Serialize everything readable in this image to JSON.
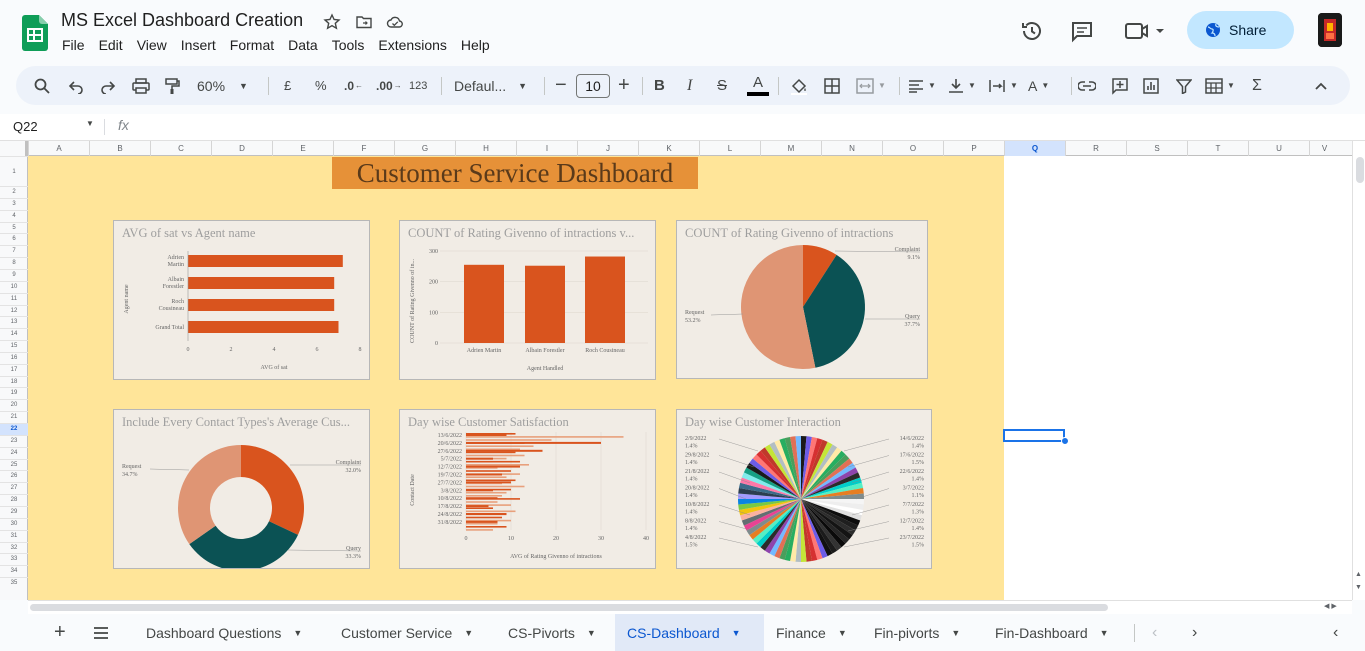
{
  "document": {
    "title": "MS Excel Dashboard Creation"
  },
  "menu": [
    "File",
    "Edit",
    "View",
    "Insert",
    "Format",
    "Data",
    "Tools",
    "Extensions",
    "Help"
  ],
  "header": {
    "share_label": "Share"
  },
  "toolbar": {
    "zoom": "60%",
    "currency": "£",
    "percent": "%",
    "dec_less": ".0",
    "dec_more": ".00",
    "number_format": "123",
    "font_name": "Defaul...",
    "font_size": "10"
  },
  "formula_bar": {
    "cell_ref": "Q22",
    "fx": "fx",
    "content": ""
  },
  "columns": [
    "A",
    "B",
    "C",
    "D",
    "E",
    "F",
    "G",
    "H",
    "I",
    "J",
    "K",
    "L",
    "M",
    "N",
    "O",
    "P",
    "Q",
    "R",
    "S",
    "T",
    "U",
    "V"
  ],
  "rows": [
    "1",
    "2",
    "3",
    "4",
    "5",
    "6",
    "7",
    "8",
    "9",
    "10",
    "11",
    "12",
    "13",
    "14",
    "15",
    "16",
    "17",
    "18",
    "19",
    "20",
    "21",
    "22",
    "23",
    "24",
    "25",
    "26",
    "27",
    "28",
    "29",
    "30",
    "31",
    "32",
    "33",
    "34",
    "35"
  ],
  "dashboard": {
    "title": "Customer Service Dashboard"
  },
  "charts": [
    {
      "title": "AVG of sat vs Agent name",
      "type": "bar",
      "categories": [
        "Adrien Martin",
        "Albain Forestler",
        "Roch Cousineau",
        "Grand Total"
      ],
      "values": [
        7.2,
        6.8,
        6.8,
        7.0
      ],
      "xlabel": "AVG of sat",
      "ylabel": "Agent name",
      "xticks": [
        "0",
        "2",
        "4",
        "6",
        "8"
      ],
      "xlim": [
        0,
        8
      ],
      "color": "#d9541e"
    },
    {
      "title": "COUNT of Rating Givenno of intractions v...",
      "type": "column",
      "categories": [
        "Adrien Martin",
        "Albain Forestler",
        "Roch Cousineau"
      ],
      "values": [
        255,
        252,
        282
      ],
      "xlabel": "Agent Handled",
      "ylabel": "COUNT of Rating Givenno of in...",
      "yticks": [
        "0",
        "100",
        "200",
        "300"
      ],
      "ylim": [
        0,
        300
      ],
      "color": "#d9541e"
    },
    {
      "title": "COUNT of Rating Givenno of intractions",
      "type": "pie",
      "slices": [
        {
          "label": "Complaint",
          "pct": "9.1%",
          "value": 9.1,
          "color": "#d9541e"
        },
        {
          "label": "Query",
          "pct": "37.7%",
          "value": 37.7,
          "color": "#0b5254"
        },
        {
          "label": "Request",
          "pct": "53.2%",
          "value": 53.2,
          "color": "#df9574"
        }
      ]
    },
    {
      "title": "Include Every Contact Types's Average Cus...",
      "type": "donut",
      "slices": [
        {
          "label": "Complaint",
          "pct": "32.0%",
          "value": 32.0,
          "color": "#d9541e"
        },
        {
          "label": "Query",
          "pct": "33.3%",
          "value": 33.3,
          "color": "#0b5254"
        },
        {
          "label": "Request",
          "pct": "34.7%",
          "value": 34.7,
          "color": "#df9574"
        }
      ]
    },
    {
      "title": "Day wise Customer Satisfaction",
      "type": "bar",
      "categories": [
        "13/6/2022",
        "20/6/2022",
        "27/6/2022",
        "5/7/2022",
        "12/7/2022",
        "19/7/2022",
        "27/7/2022",
        "3/8/2022",
        "10/8/2022",
        "17/8/2022",
        "24/8/2022",
        "31/8/2022"
      ],
      "values": [
        9,
        30,
        17,
        6,
        12,
        8,
        10,
        6,
        7,
        5,
        9,
        7
      ],
      "xlabel": "AVG of Rating Givenno of intractions",
      "ylabel": "Contact Date",
      "xticks": [
        "0",
        "10",
        "20",
        "30",
        "40"
      ],
      "xlim": [
        0,
        40
      ],
      "color": "#d9541e"
    },
    {
      "title": "Day wise Customer Interaction",
      "type": "pie",
      "left_labels": [
        {
          "date": "2/9/2022",
          "pct": "1.4%"
        },
        {
          "date": "29/8/2022",
          "pct": "1.4%"
        },
        {
          "date": "21/8/2022",
          "pct": "1.4%"
        },
        {
          "date": "20/8/2022",
          "pct": "1.4%"
        },
        {
          "date": "10/8/2022",
          "pct": "1.4%"
        },
        {
          "date": "8/8/2022",
          "pct": "1.4%"
        },
        {
          "date": "4/8/2022",
          "pct": "1.5%"
        }
      ],
      "right_labels": [
        {
          "date": "14/6/2022",
          "pct": "1.4%"
        },
        {
          "date": "17/6/2022",
          "pct": "1.5%"
        },
        {
          "date": "22/6/2022",
          "pct": "1.4%"
        },
        {
          "date": "3/7/2022",
          "pct": "1.1%"
        },
        {
          "date": "7/7/2022",
          "pct": "1.3%"
        },
        {
          "date": "12/7/2022",
          "pct": "1.4%"
        },
        {
          "date": "23/7/2022",
          "pct": "1.5%"
        }
      ]
    }
  ],
  "sheets": [
    {
      "label": "Dashboard Questions",
      "active": false
    },
    {
      "label": "Customer Service",
      "active": false
    },
    {
      "label": "CS-Pivorts",
      "active": false
    },
    {
      "label": "CS-Dashboard",
      "active": true
    },
    {
      "label": "Finance",
      "active": false
    },
    {
      "label": "Fin-pivorts",
      "active": false
    },
    {
      "label": "Fin-Dashboard",
      "active": false
    }
  ]
}
